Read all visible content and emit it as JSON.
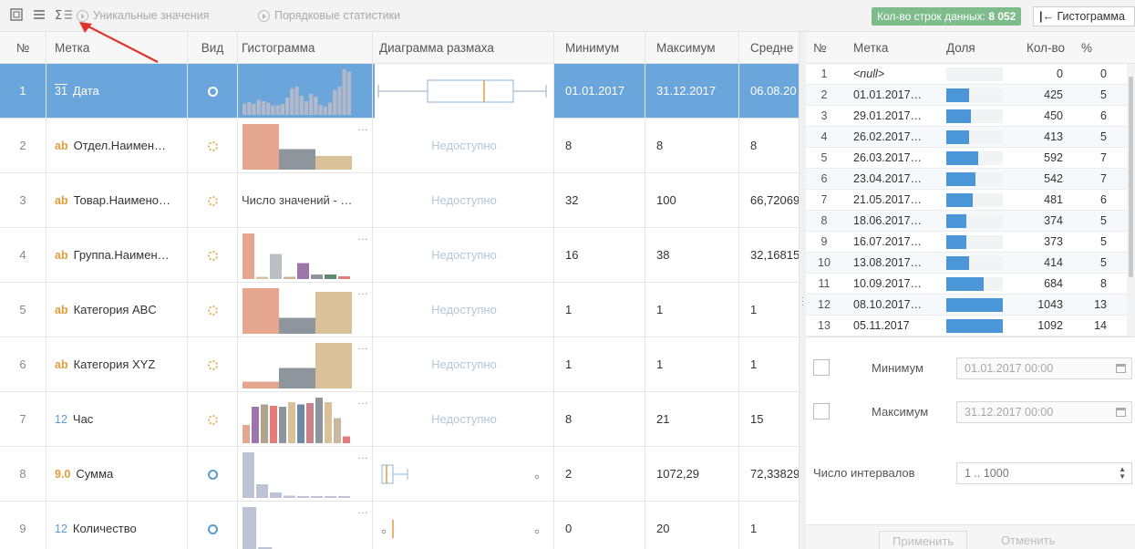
{
  "toolbar": {
    "unique_label": "Уникальные значения",
    "ordinal_label": "Порядковые статистики",
    "row_count_label": "Кол-во строк данных:",
    "row_count_value": "8 052",
    "histogram_button": "Гистограмма"
  },
  "main": {
    "headers": {
      "num": "№",
      "label": "Метка",
      "kind": "Вид",
      "histogram": "Гистограмма",
      "boxplot": "Диаграмма размаха",
      "min": "Минимум",
      "max": "Максимум",
      "mean": "Средне"
    },
    "rows": [
      {
        "num": "1",
        "type": "31",
        "label": "Дата",
        "kind": "white",
        "hist": "date",
        "box": "date",
        "min": "01.01.2017",
        "max": "31.12.2017",
        "mean": "06.08.20"
      },
      {
        "num": "2",
        "type": "ab",
        "label": "Отдел.Наимен…",
        "kind": "orange",
        "hist": "dept",
        "box": "Недоступно",
        "min": "8",
        "max": "8",
        "mean": "8"
      },
      {
        "num": "3",
        "type": "ab",
        "label": "Товар.Наимено…",
        "kind": "orange",
        "hist": "text",
        "hist_text": "Число значений - …",
        "box": "Недоступно",
        "min": "32",
        "max": "100",
        "mean": "66,72069"
      },
      {
        "num": "4",
        "type": "ab",
        "label": "Группа.Наимен…",
        "kind": "orange",
        "hist": "group",
        "box": "Недоступно",
        "min": "16",
        "max": "38",
        "mean": "32,16815"
      },
      {
        "num": "5",
        "type": "ab",
        "label": "Категория ABC",
        "kind": "orange",
        "hist": "abc",
        "box": "Недоступно",
        "min": "1",
        "max": "1",
        "mean": "1"
      },
      {
        "num": "6",
        "type": "ab",
        "label": "Категория XYZ",
        "kind": "orange",
        "hist": "xyz",
        "box": "Недоступно",
        "min": "1",
        "max": "1",
        "mean": "1"
      },
      {
        "num": "7",
        "type": "12",
        "label": "Час",
        "kind": "orange",
        "hist": "hour",
        "box": "Недоступно",
        "min": "8",
        "max": "21",
        "mean": "15"
      },
      {
        "num": "8",
        "type": "9.0",
        "label": "Сумма",
        "kind": "blue",
        "hist": "sum",
        "box": "sum",
        "min": "2",
        "max": "1072,29",
        "mean": "72,33829"
      },
      {
        "num": "9",
        "type": "12",
        "label": "Количество",
        "kind": "blue",
        "hist": "qty",
        "box": "qty",
        "min": "0",
        "max": "20",
        "mean": "1"
      }
    ]
  },
  "panel": {
    "headers": {
      "num": "№",
      "label": "Метка",
      "share": "Доля",
      "count": "Кол-во",
      "pct": "%"
    },
    "rows": [
      {
        "num": "1",
        "label": "<null>",
        "share": 0,
        "count": "0",
        "pct": "0"
      },
      {
        "num": "2",
        "label": "01.01.2017…",
        "share": 0.41,
        "count": "425",
        "pct": "5"
      },
      {
        "num": "3",
        "label": "29.01.2017…",
        "share": 0.43,
        "count": "450",
        "pct": "6"
      },
      {
        "num": "4",
        "label": "26.02.2017…",
        "share": 0.4,
        "count": "413",
        "pct": "5"
      },
      {
        "num": "5",
        "label": "26.03.2017…",
        "share": 0.57,
        "count": "592",
        "pct": "7"
      },
      {
        "num": "6",
        "label": "23.04.2017…",
        "share": 0.52,
        "count": "542",
        "pct": "7"
      },
      {
        "num": "7",
        "label": "21.05.2017…",
        "share": 0.46,
        "count": "481",
        "pct": "6"
      },
      {
        "num": "8",
        "label": "18.06.2017…",
        "share": 0.36,
        "count": "374",
        "pct": "5"
      },
      {
        "num": "9",
        "label": "16.07.2017…",
        "share": 0.36,
        "count": "373",
        "pct": "5"
      },
      {
        "num": "10",
        "label": "13.08.2017…",
        "share": 0.4,
        "count": "414",
        "pct": "5"
      },
      {
        "num": "11",
        "label": "10.09.2017…",
        "share": 0.66,
        "count": "684",
        "pct": "8"
      },
      {
        "num": "12",
        "label": "08.10.2017…",
        "share": 1.0,
        "count": "1043",
        "pct": "13"
      },
      {
        "num": "13",
        "label": "05.11.2017",
        "share": 1.0,
        "count": "1092",
        "pct": "14"
      }
    ],
    "min_label": "Минимум",
    "min_value": "01.01.2017 00:00",
    "max_label": "Максимум",
    "max_value": "31.12.2017 00:00",
    "intervals_label": "Число интервалов",
    "intervals_value": "1 .. 1000",
    "apply": "Применить",
    "cancel": "Отменить"
  },
  "colors": {
    "selected_row": "#6aa6db",
    "badge": "#7ebd8b",
    "share_bar": "#4a96d6",
    "text_type": "#e39b3b",
    "num_type": "#5b9bd5"
  }
}
